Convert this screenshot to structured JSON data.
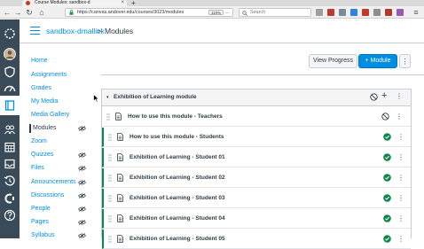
{
  "browser": {
    "tab_title": "Course Modules: sandbox-d",
    "new_tab_label": "+",
    "url": "https://canvas.andover.edu/courses/3023/modules",
    "zoom": "110%",
    "search_placeholder": "Search",
    "page_actions_label": "…",
    "back_icon": "back-arrow-icon",
    "forward_icon": "forward-arrow-icon",
    "reload_icon": "reload-icon",
    "home_icon": "home-icon"
  },
  "global_nav": {
    "items": [
      "logo-icon",
      "account-avatar",
      "admin-shield-icon",
      "dashboard-icon",
      "courses-icon",
      "groups-icon",
      "calendar-icon",
      "inbox-icon",
      "history-icon",
      "commons-icon",
      "help-icon"
    ]
  },
  "header": {
    "course": "sandbox-dmallick",
    "separator": ">",
    "page": "Modules"
  },
  "course_nav": [
    {
      "label": "Home",
      "hidden": false,
      "active": false
    },
    {
      "label": "Assignments",
      "hidden": false,
      "active": false
    },
    {
      "label": "Grades",
      "hidden": false,
      "active": false
    },
    {
      "label": "My Media",
      "hidden": false,
      "active": false
    },
    {
      "label": "Media Gallery",
      "hidden": false,
      "active": false
    },
    {
      "label": "Modules",
      "hidden": true,
      "active": true
    },
    {
      "label": "Zoom",
      "hidden": false,
      "active": false
    },
    {
      "label": "Quizzes",
      "hidden": true,
      "active": false
    },
    {
      "label": "Files",
      "hidden": true,
      "active": false
    },
    {
      "label": "Announcements",
      "hidden": true,
      "active": false
    },
    {
      "label": "Discussions",
      "hidden": true,
      "active": false
    },
    {
      "label": "People",
      "hidden": true,
      "active": false
    },
    {
      "label": "Pages",
      "hidden": true,
      "active": false
    },
    {
      "label": "Syllabus",
      "hidden": true,
      "active": false
    }
  ],
  "toolbar": {
    "view_progress": "View Progress",
    "add_module": "+ Module",
    "more": "⋮"
  },
  "module": {
    "title": "Exhibition of Learning module",
    "caret": "▾",
    "items": [
      {
        "title": "How to use this module - Teachers",
        "published": false
      },
      {
        "title": "How to use this module - Students",
        "published": true
      },
      {
        "title": "Exhibition of Learning - Student 01",
        "published": true
      },
      {
        "title": "Exhibition of Learning - Student 02",
        "published": true
      },
      {
        "title": "Exhibition of Learning - Student 03",
        "published": true
      },
      {
        "title": "Exhibition of Learning - Student 04",
        "published": true
      },
      {
        "title": "Exhibition of Learning - Student 05",
        "published": true
      }
    ]
  },
  "colors": {
    "link": "#008ee2",
    "nav_bg": "#394b58",
    "published": "#0b874b",
    "text": "#2d3b45"
  }
}
